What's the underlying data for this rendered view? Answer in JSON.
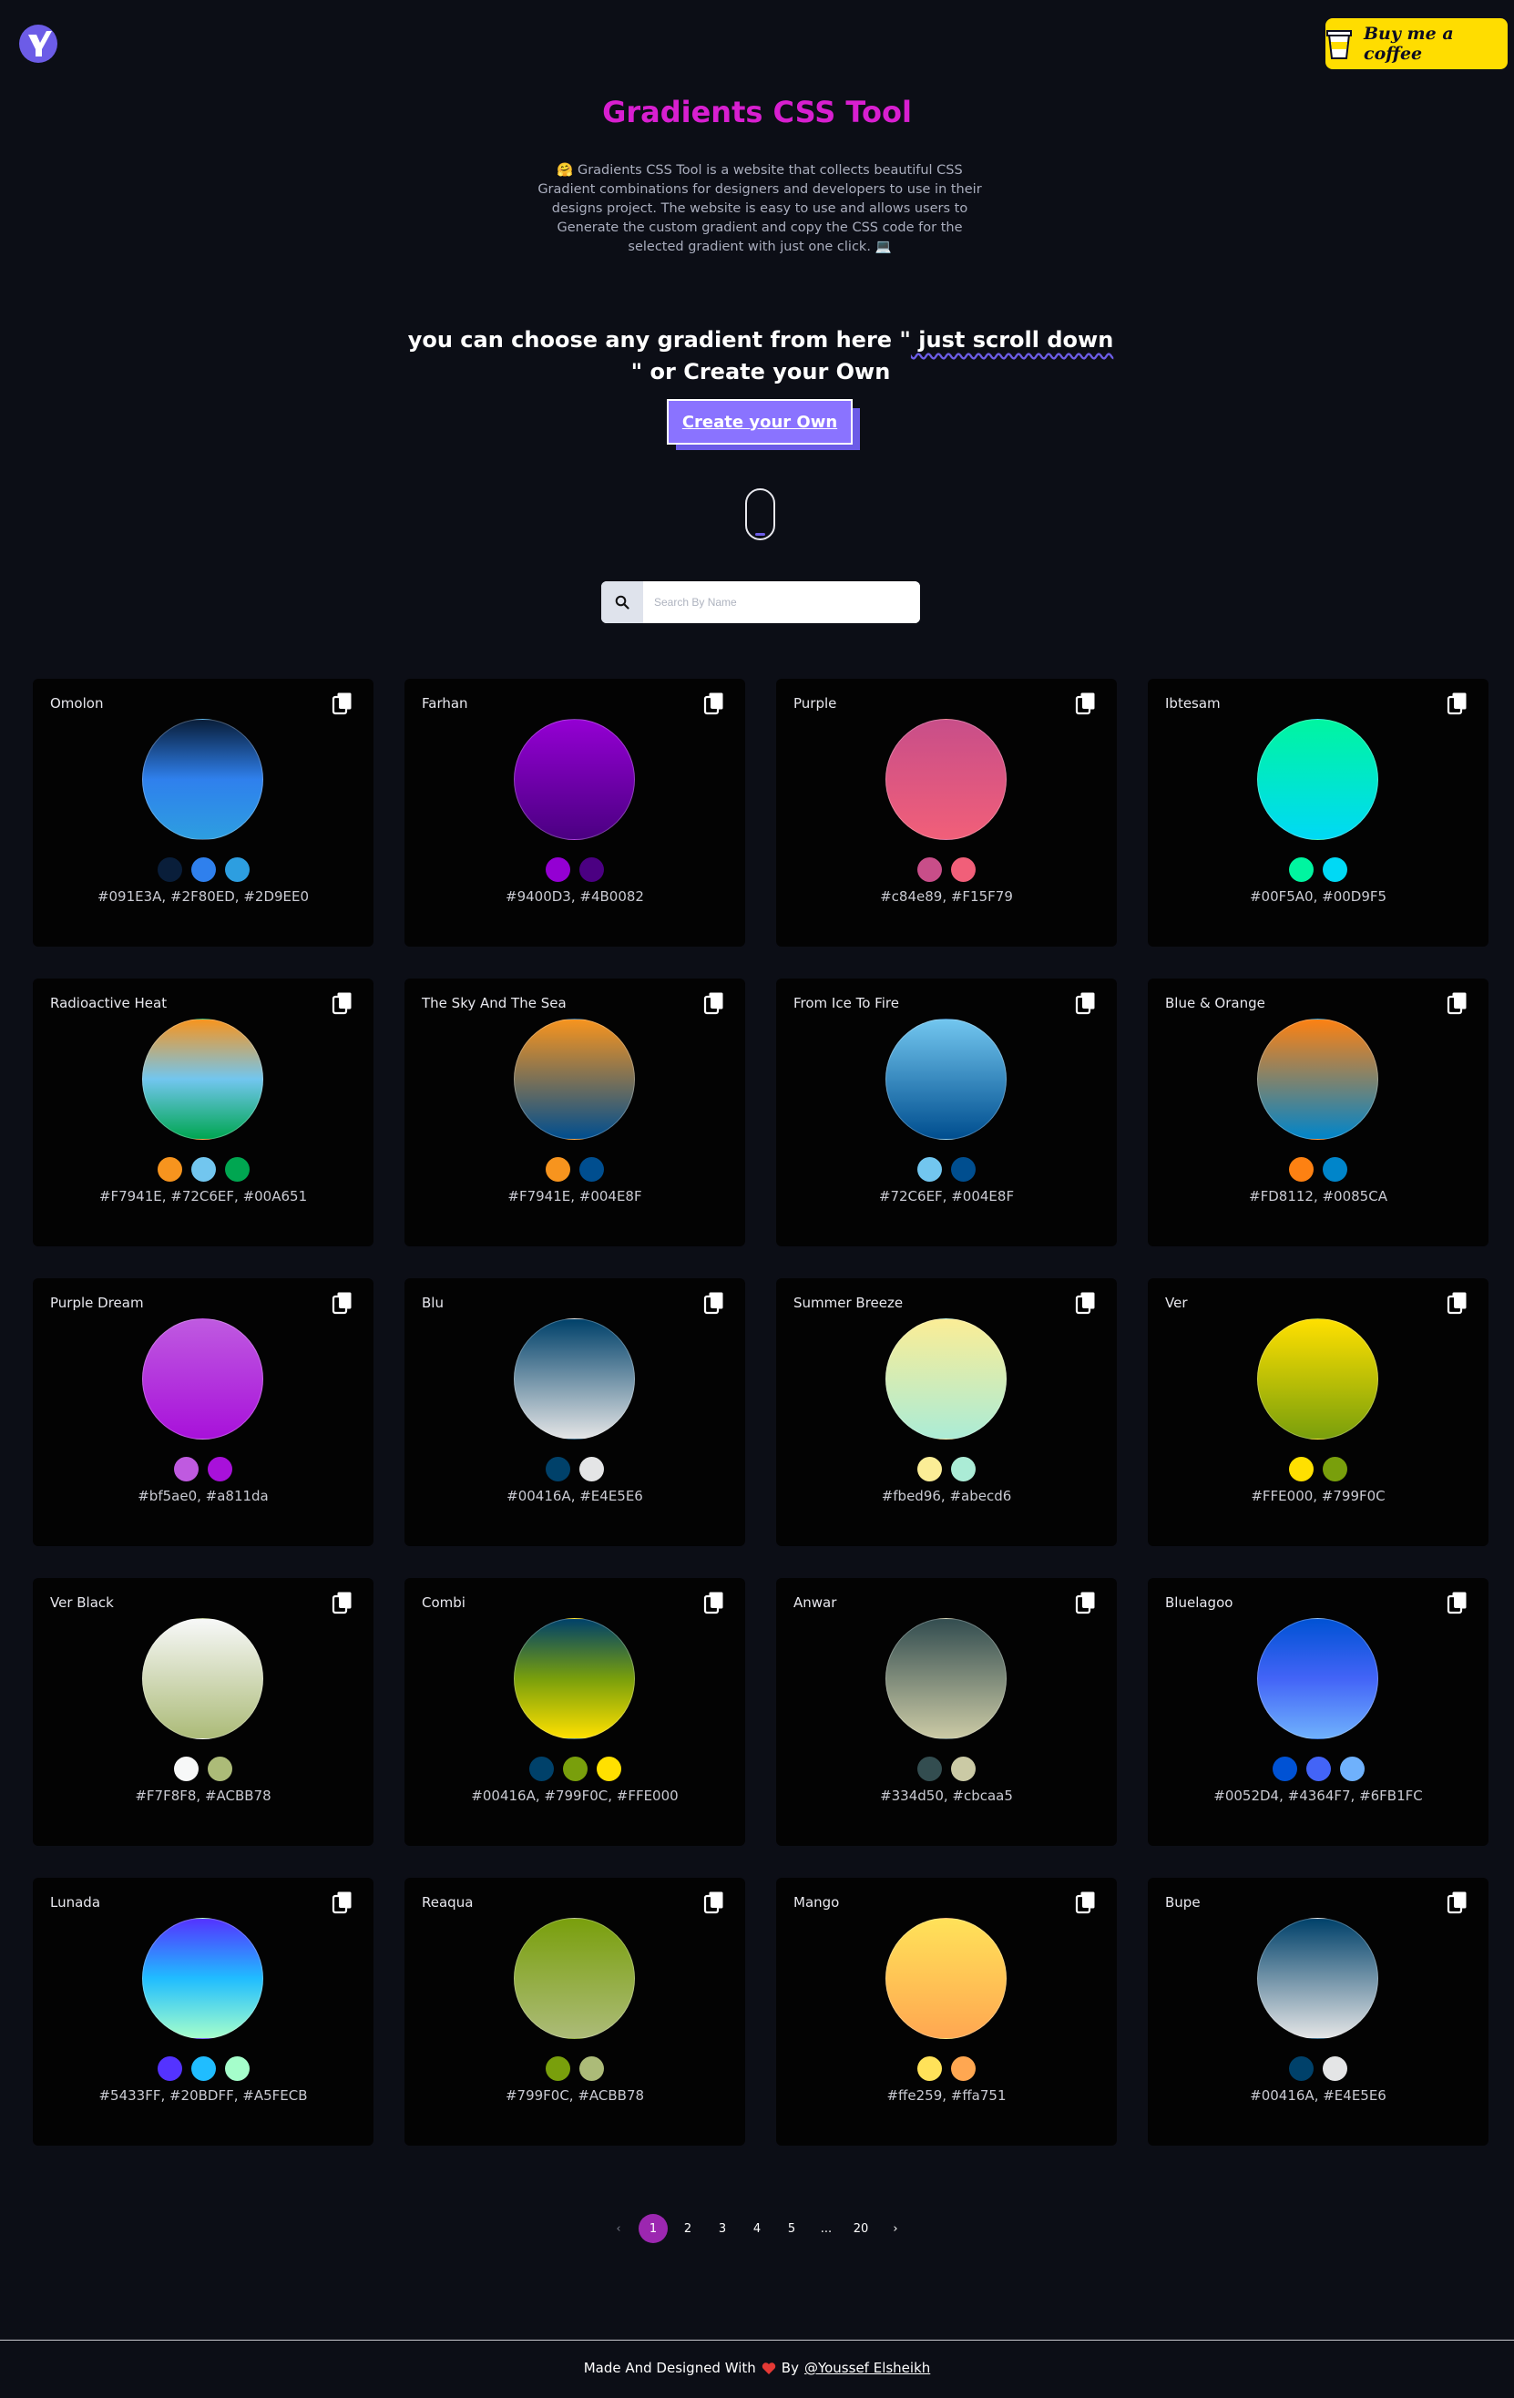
{
  "header": {
    "coffee_label": "Buy me a coffee"
  },
  "hero": {
    "title": "Gradients CSS Tool",
    "intro": "🤗 Gradients CSS Tool is a website that collects beautiful CSS Gradient combinations for designers and developers to use in their designs project. The website is easy to use and allows users to Generate the custom gradient and copy the CSS code for the selected gradient with just one click. 💻",
    "cta_prefix": "you can choose any gradient from here \"",
    "cta_highlight": " just scroll down ",
    "cta_suffix": "\" or Create your Own",
    "create_label": "Create your Own"
  },
  "search": {
    "placeholder": "Search By Name"
  },
  "gradients": [
    {
      "name": "Omolon",
      "colors": [
        "#091E3A",
        "#2F80ED",
        "#2D9EE0"
      ],
      "codes": "#091E3A, #2F80ED, #2D9EE0"
    },
    {
      "name": "Farhan",
      "colors": [
        "#9400D3",
        "#4B0082"
      ],
      "codes": "#9400D3, #4B0082"
    },
    {
      "name": "Purple",
      "colors": [
        "#c84e89",
        "#F15F79"
      ],
      "codes": "#c84e89, #F15F79"
    },
    {
      "name": "Ibtesam",
      "colors": [
        "#00F5A0",
        "#00D9F5"
      ],
      "codes": "#00F5A0, #00D9F5"
    },
    {
      "name": "Radioactive Heat",
      "colors": [
        "#F7941E",
        "#72C6EF",
        "#00A651"
      ],
      "codes": "#F7941E, #72C6EF, #00A651"
    },
    {
      "name": "The Sky And The Sea",
      "colors": [
        "#F7941E",
        "#004E8F"
      ],
      "codes": "#F7941E, #004E8F"
    },
    {
      "name": "From Ice To Fire",
      "colors": [
        "#72C6EF",
        "#004E8F"
      ],
      "codes": "#72C6EF, #004E8F"
    },
    {
      "name": "Blue & Orange",
      "colors": [
        "#FD8112",
        "#0085CA"
      ],
      "codes": "#FD8112, #0085CA"
    },
    {
      "name": "Purple Dream",
      "colors": [
        "#bf5ae0",
        "#a811da"
      ],
      "codes": "#bf5ae0, #a811da"
    },
    {
      "name": "Blu",
      "colors": [
        "#00416A",
        "#E4E5E6"
      ],
      "codes": "#00416A, #E4E5E6"
    },
    {
      "name": "Summer Breeze",
      "colors": [
        "#fbed96",
        "#abecd6"
      ],
      "codes": "#fbed96, #abecd6"
    },
    {
      "name": "Ver",
      "colors": [
        "#FFE000",
        "#799F0C"
      ],
      "codes": "#FFE000, #799F0C"
    },
    {
      "name": "Ver Black",
      "colors": [
        "#F7F8F8",
        "#ACBB78"
      ],
      "codes": "#F7F8F8, #ACBB78"
    },
    {
      "name": "Combi",
      "colors": [
        "#00416A",
        "#799F0C",
        "#FFE000"
      ],
      "codes": "#00416A, #799F0C, #FFE000"
    },
    {
      "name": "Anwar",
      "colors": [
        "#334d50",
        "#cbcaa5"
      ],
      "codes": "#334d50, #cbcaa5"
    },
    {
      "name": "Bluelagoo",
      "colors": [
        "#0052D4",
        "#4364F7",
        "#6FB1FC"
      ],
      "codes": "#0052D4, #4364F7, #6FB1FC"
    },
    {
      "name": "Lunada",
      "colors": [
        "#5433FF",
        "#20BDFF",
        "#A5FECB"
      ],
      "codes": "#5433FF, #20BDFF, #A5FECB"
    },
    {
      "name": "Reaqua",
      "colors": [
        "#799F0C",
        "#ACBB78"
      ],
      "codes": "#799F0C, #ACBB78"
    },
    {
      "name": "Mango",
      "colors": [
        "#ffe259",
        "#ffa751"
      ],
      "codes": "#ffe259, #ffa751"
    },
    {
      "name": "Bupe",
      "colors": [
        "#00416A",
        "#E4E5E6"
      ],
      "codes": "#00416A, #E4E5E6"
    }
  ],
  "pagination": {
    "prev": "‹",
    "pages": [
      "1",
      "2",
      "3",
      "4",
      "5",
      "...",
      "20"
    ],
    "active": "1",
    "next": "›"
  },
  "footer": {
    "prefix": "Made And Designed With",
    "by": "By",
    "author": "@Youssef Elsheikh"
  },
  "colors": {
    "background": "#0c0e16",
    "accent": "#6c5ce7",
    "title": "#d81fd0",
    "coffee": "#ffdd00",
    "active_page": "#9c27b0"
  }
}
